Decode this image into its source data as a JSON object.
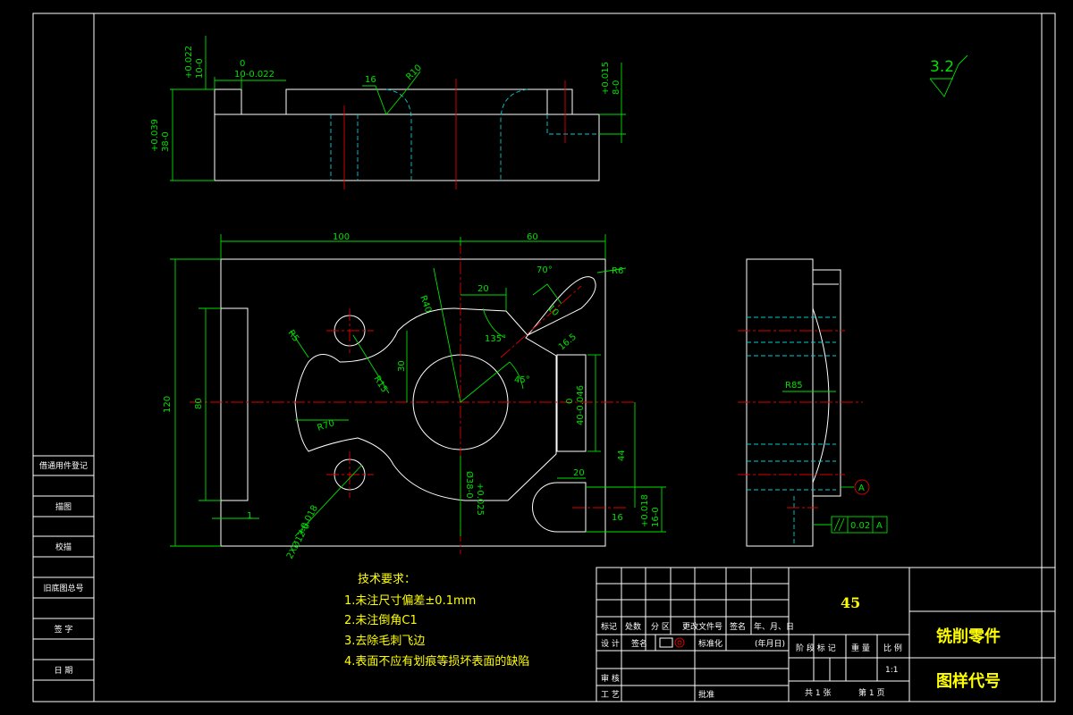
{
  "dims": {
    "top_width_tol_top": "+0.022",
    "top_width_tol_bot": "10-0",
    "top_width_tol2_top": "0",
    "top_width_tol2_bot": "10-0.022",
    "top_16": "16",
    "top_r10": "R10",
    "top_right_tol_top": "+0.015",
    "top_right_tol_bot": "8-0",
    "top_height_top": "+0.039",
    "top_height_bot": "38-0",
    "front_100": "100",
    "front_60": "60",
    "front_120": "120",
    "front_80": "80",
    "front_1": "1",
    "front_20": "20",
    "front_r40": "R40",
    "front_r6": "R6",
    "front_r5": "R5",
    "front_70deg": "70°",
    "front_10": "10",
    "front_16_5": "16.5",
    "front_135": "135°",
    "front_45": "45°",
    "front_30": "30",
    "front_r15": "R15",
    "front_r70": "R70",
    "front_slot_tol_top": "0",
    "front_slot_tol_bot": "40-0.046",
    "front_44": "44",
    "front_20b": "20",
    "front_16b": "16",
    "front_bore_tol_top": "+0.025",
    "front_bore_tol_bot": "Ø38-0",
    "front_holes_tol_top": "+0.018",
    "front_holes_tol_bot": "2XØ12-0",
    "front_small_tol_top": "+0.018",
    "front_small_tol_bot": "16-0",
    "side_r85": "R85",
    "datum": "A",
    "parallel_val": "0.02",
    "parallel_ref": "A",
    "roughness": "3.2"
  },
  "tech": {
    "title": "技术要求：",
    "items": [
      "1.未注尺寸偏差±0.1mm",
      "2.未注倒角C1",
      "3.去除毛刺飞边",
      "4.表面不应有划痕等损坏表面的缺陷"
    ]
  },
  "left_strip": {
    "cells": [
      "借通用件登记",
      "描图",
      "校描",
      "旧底图总号",
      "签 字",
      "日 期"
    ]
  },
  "title_block": {
    "material": "45",
    "part_name": "铣削零件",
    "drawing_no": "图样代号",
    "row_labels": [
      "标记",
      "处数",
      "分 区",
      "更改文件号",
      "签名",
      "年、月、日"
    ],
    "design": "设 计",
    "sign": "签名",
    "std": "标准化",
    "date": "(年月日)",
    "review": "审 核",
    "process": "工 艺",
    "approve": "批准",
    "stage_labels": [
      "阶 段 标 记",
      "重 量",
      "比 例"
    ],
    "scale": "1:1",
    "sheets_total": "共 1 张",
    "sheet_no": "第 1 页"
  }
}
